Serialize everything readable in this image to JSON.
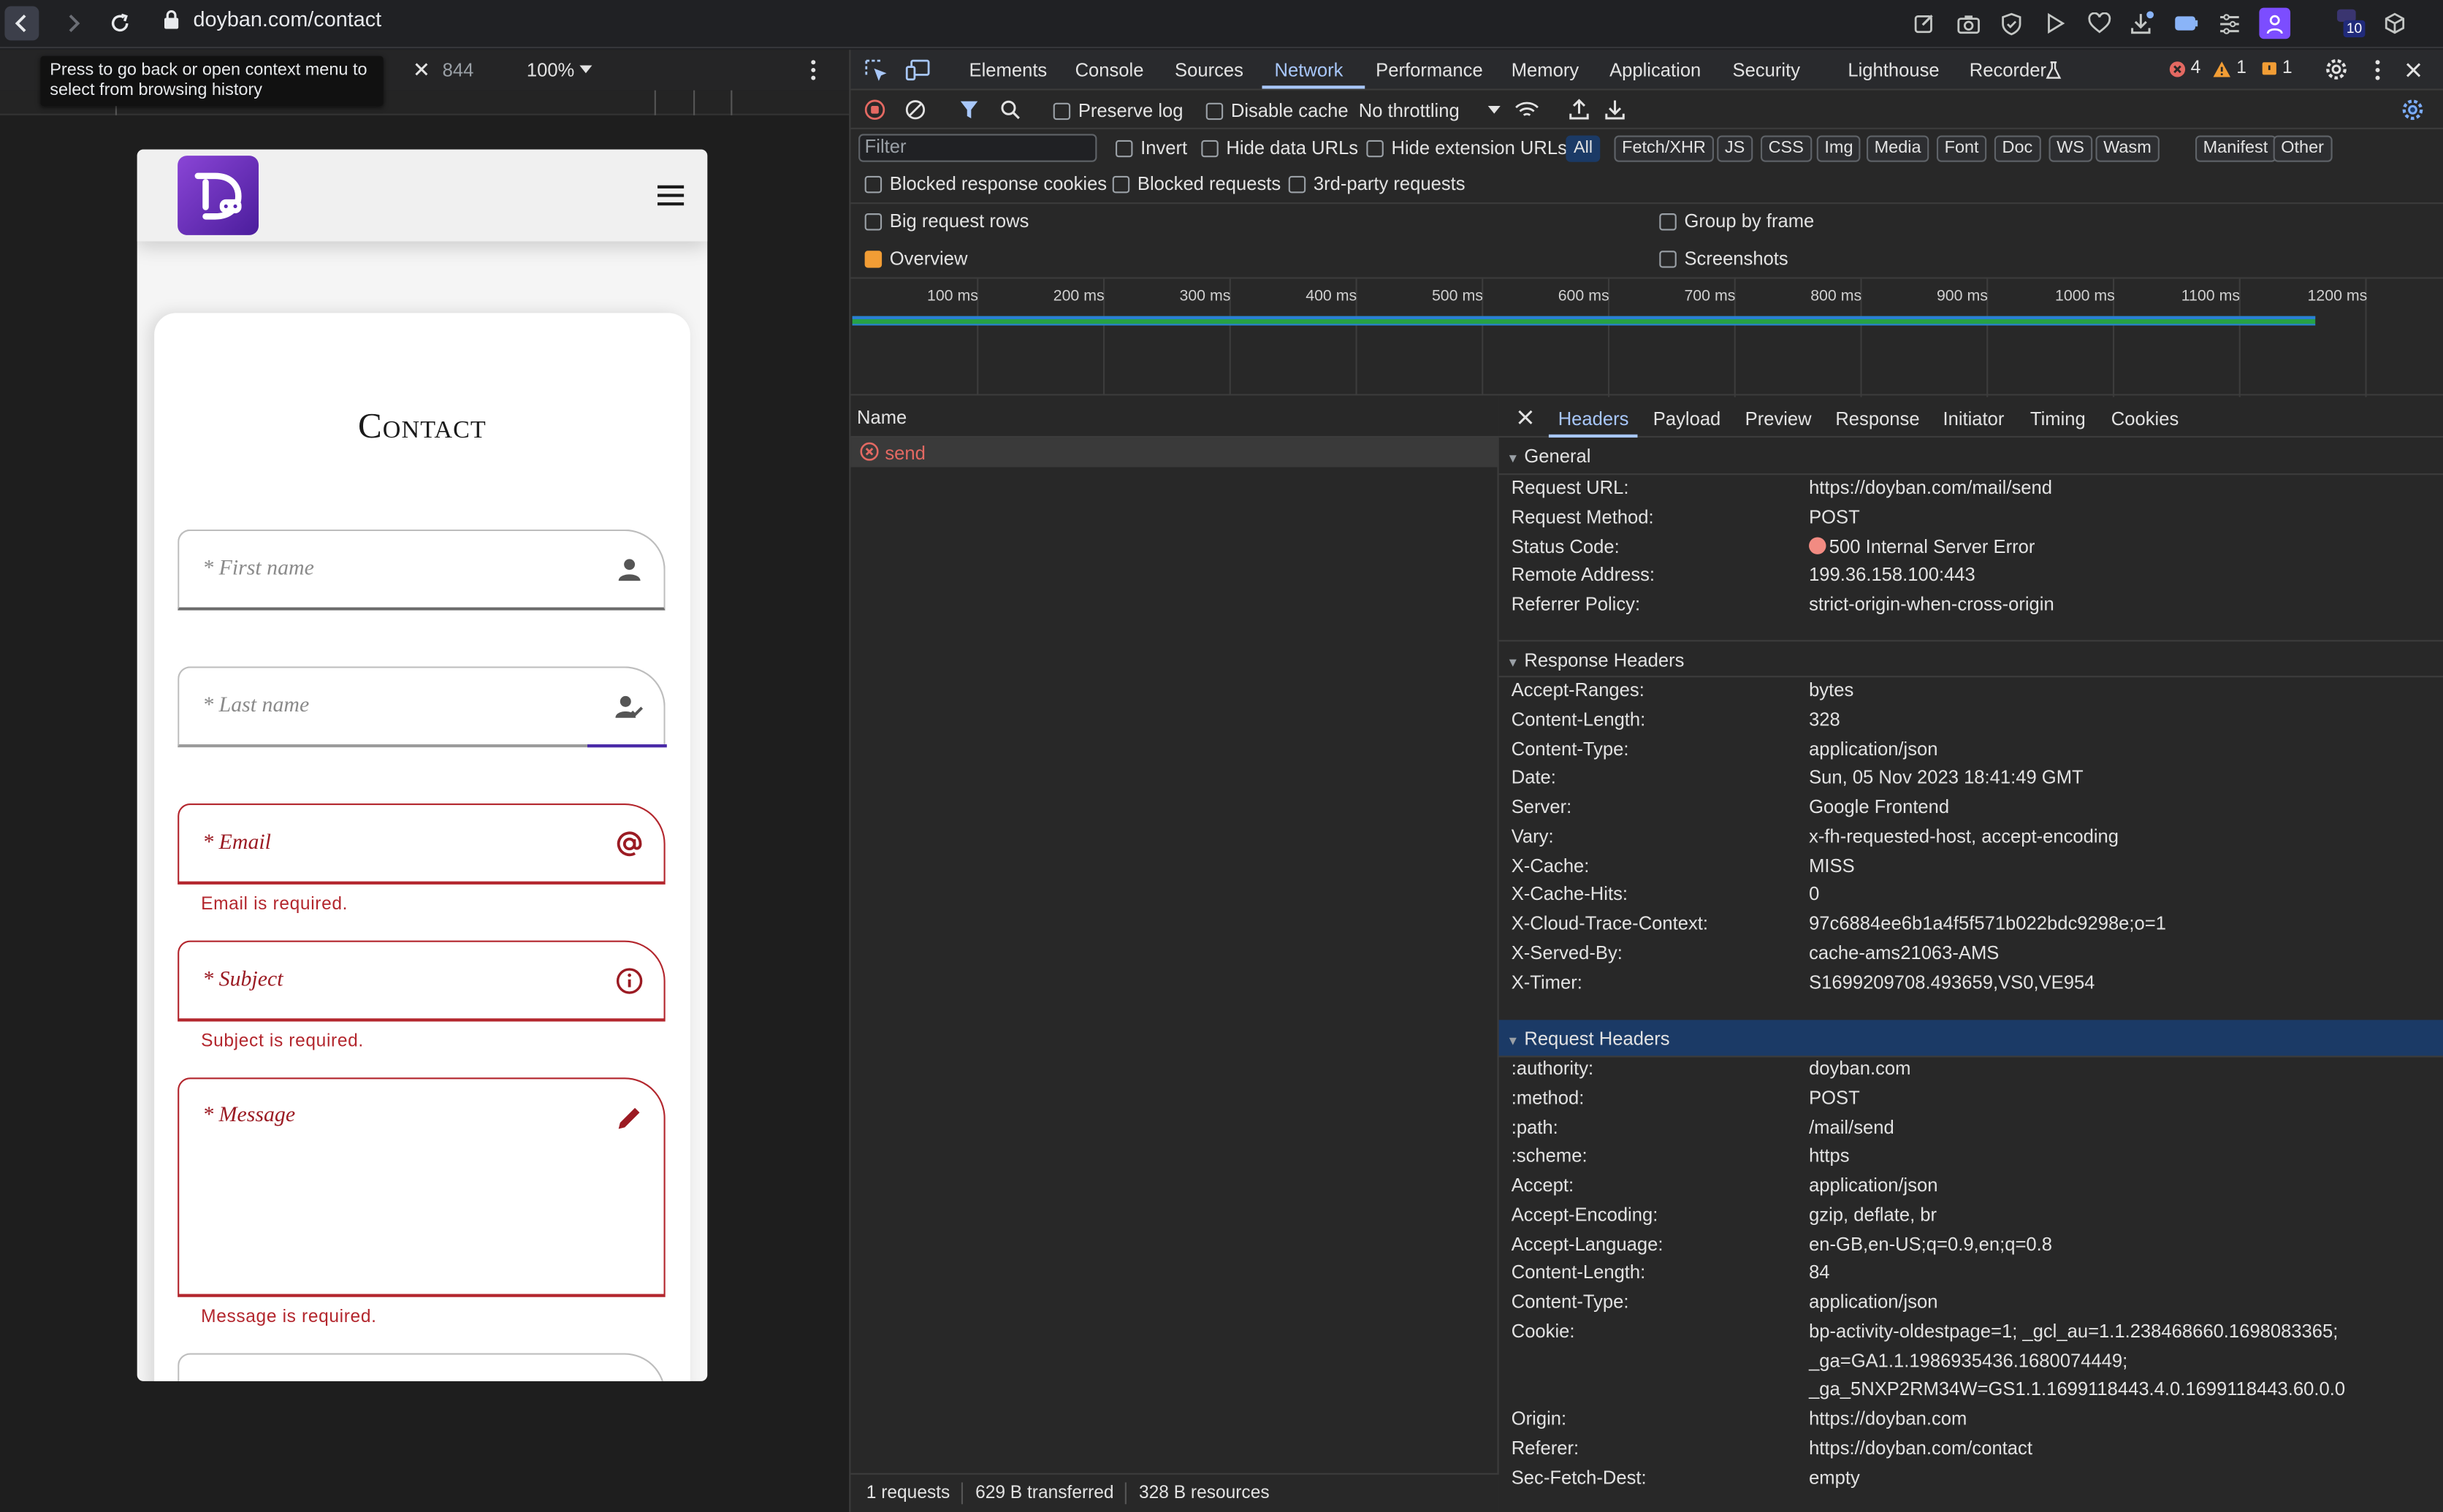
{
  "browser": {
    "url": "doyban.com/contact",
    "extension_badge": "10"
  },
  "emulator": {
    "tooltip": "Press to go back or open context menu to select from browsing history",
    "height": "844",
    "zoom": "100%"
  },
  "page": {
    "title": "Contact",
    "fields": [
      {
        "placeholder": "* First name",
        "icon": "person-icon",
        "error": ""
      },
      {
        "placeholder": "* Last name",
        "icon": "person-check-icon",
        "error": ""
      },
      {
        "placeholder": "* Email",
        "icon": "at-sign-icon",
        "error": "Email is required."
      },
      {
        "placeholder": "* Subject",
        "icon": "info-icon",
        "error": "Subject is required."
      },
      {
        "placeholder": "* Message",
        "icon": "pencil-icon",
        "error": "Message is required."
      }
    ]
  },
  "devtools": {
    "tabs": [
      "Elements",
      "Console",
      "Sources",
      "Network",
      "Performance",
      "Memory",
      "Application",
      "Security",
      "Lighthouse",
      "Recorder"
    ],
    "active_tab": "Network",
    "counts": {
      "errors": "4",
      "warnings": "1",
      "issues": "1"
    },
    "toolbar": {
      "preserve_log": "Preserve log",
      "disable_cache": "Disable cache",
      "throttling": "No throttling"
    },
    "filter": {
      "placeholder": "Filter",
      "invert": "Invert",
      "hide_data": "Hide data URLs",
      "hide_ext": "Hide extension URLs",
      "chips": [
        "All",
        "Fetch/XHR",
        "JS",
        "CSS",
        "Img",
        "Media",
        "Font",
        "Doc",
        "WS",
        "Wasm",
        "Manifest",
        "Other"
      ]
    },
    "options": {
      "blocked_cookies": "Blocked response cookies",
      "blocked_requests": "Blocked requests",
      "third_party": "3rd-party requests",
      "big_rows": "Big request rows",
      "group_frame": "Group by frame",
      "overview": "Overview",
      "screenshots": "Screenshots"
    },
    "timeline": [
      "100 ms",
      "200 ms",
      "300 ms",
      "400 ms",
      "500 ms",
      "600 ms",
      "700 ms",
      "800 ms",
      "900 ms",
      "1000 ms",
      "1100 ms",
      "1200 ms"
    ],
    "list": {
      "header": "Name",
      "request": "send"
    },
    "status": {
      "requests": "1 requests",
      "transferred": "629 B transferred",
      "resources": "328 B resources"
    },
    "detail_tabs": [
      "Headers",
      "Payload",
      "Preview",
      "Response",
      "Initiator",
      "Timing",
      "Cookies"
    ],
    "general": {
      "title": "General",
      "rows": [
        [
          "Request URL:",
          "https://doyban.com/mail/send"
        ],
        [
          "Request Method:",
          "POST"
        ],
        [
          "Status Code:",
          "500 Internal Server Error"
        ],
        [
          "Remote Address:",
          "199.36.158.100:443"
        ],
        [
          "Referrer Policy:",
          "strict-origin-when-cross-origin"
        ]
      ]
    },
    "response": {
      "title": "Response Headers",
      "rows": [
        [
          "Accept-Ranges:",
          "bytes"
        ],
        [
          "Content-Length:",
          "328"
        ],
        [
          "Content-Type:",
          "application/json"
        ],
        [
          "Date:",
          "Sun, 05 Nov 2023 18:41:49 GMT"
        ],
        [
          "Server:",
          "Google Frontend"
        ],
        [
          "Vary:",
          "x-fh-requested-host, accept-encoding"
        ],
        [
          "X-Cache:",
          "MISS"
        ],
        [
          "X-Cache-Hits:",
          "0"
        ],
        [
          "X-Cloud-Trace-Context:",
          "97c6884ee6b1a4f5f571b022bdc9298e;o=1"
        ],
        [
          "X-Served-By:",
          "cache-ams21063-AMS"
        ],
        [
          "X-Timer:",
          "S1699209708.493659,VS0,VE954"
        ]
      ]
    },
    "request": {
      "title": "Request Headers",
      "rows": [
        [
          ":authority:",
          "doyban.com"
        ],
        [
          ":method:",
          "POST"
        ],
        [
          ":path:",
          "/mail/send"
        ],
        [
          ":scheme:",
          "https"
        ],
        [
          "Accept:",
          "application/json"
        ],
        [
          "Accept-Encoding:",
          "gzip, deflate, br"
        ],
        [
          "Accept-Language:",
          "en-GB,en-US;q=0.9,en;q=0.8"
        ],
        [
          "Content-Length:",
          "84"
        ],
        [
          "Content-Type:",
          "application/json"
        ],
        [
          "Cookie:",
          "bp-activity-oldestpage=1; _gcl_au=1.1.238468660.1698083365;"
        ],
        [
          "",
          "_ga=GA1.1.1986935436.1680074449;"
        ],
        [
          "",
          "_ga_5NXP2RM34W=GS1.1.1699118443.4.0.1699118443.60.0.0"
        ],
        [
          "Origin:",
          "https://doyban.com"
        ],
        [
          "Referer:",
          "https://doyban.com/contact"
        ],
        [
          "Sec-Fetch-Dest:",
          "empty"
        ]
      ]
    }
  }
}
